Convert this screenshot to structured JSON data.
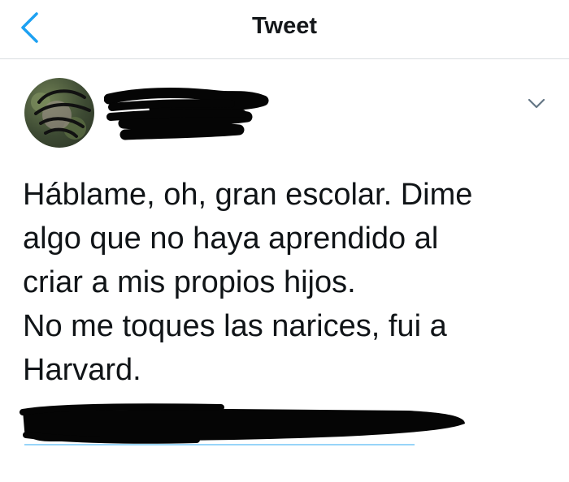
{
  "header": {
    "title": "Tweet"
  },
  "icons": {
    "back": "chevron-left-icon",
    "more": "chevron-down-icon"
  },
  "colors": {
    "accent": "#1da1f2",
    "text": "#101417",
    "divider": "#d9dde1"
  },
  "tweet": {
    "text": "Háblame, oh, gran escolar. Dime\nalgo que no haya aprendido al\ncriar a mis propios hijos.\nNo me toques las narices, fui a\nHarvard."
  }
}
